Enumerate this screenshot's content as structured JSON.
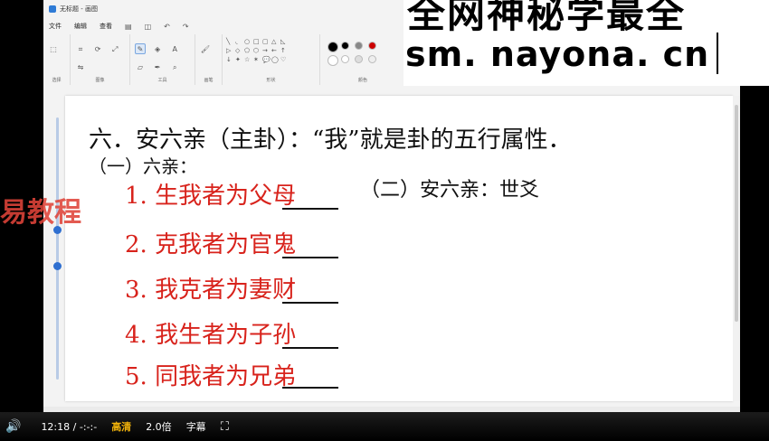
{
  "window": {
    "title": "无标题 - 画图"
  },
  "menu": [
    "文件",
    "编辑",
    "查看"
  ],
  "ribbon": {
    "groups": [
      "选择",
      "图像",
      "工具",
      "画笔",
      "形状",
      "颜色"
    ]
  },
  "watermark": {
    "line1": "全网神秘学最全",
    "line2": "sm. nayona. cn",
    "left_text": "易教程"
  },
  "notes": {
    "heading": "六．安六亲（主卦）：“我”就是卦的五行属性．",
    "sub1": "（一）六亲：",
    "sub2": "（二）安六亲：世爻",
    "items": [
      {
        "prefix": "1. 生我者为",
        "target": "父母"
      },
      {
        "prefix": "2. 克我者为",
        "target": "官鬼"
      },
      {
        "prefix": "3. 我克者为",
        "target": "妻财"
      },
      {
        "prefix": "4. 我生者为",
        "target": "子孙"
      },
      {
        "prefix": "5. 同我者为",
        "target": "兄弟"
      }
    ]
  },
  "player": {
    "time_current": "12:18",
    "time_sep": "/",
    "time_total": "-:-:-",
    "quality": "高清",
    "speed": "2.0倍",
    "subtitle": "字幕"
  },
  "colors": {
    "ink_black": "#111111",
    "ink_red": "#d8231c",
    "accent": "#2f6fd0",
    "quality": "#f1b20a"
  }
}
